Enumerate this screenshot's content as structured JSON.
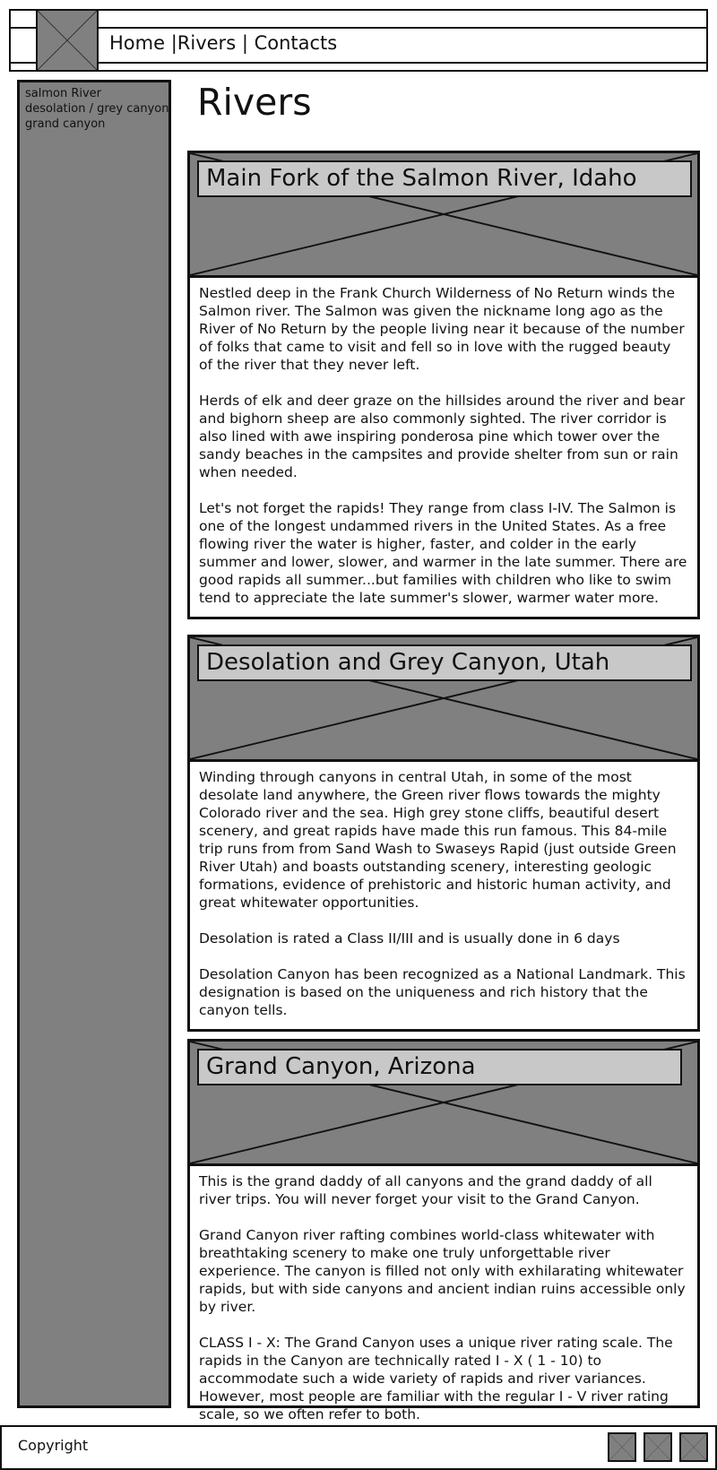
{
  "header": {
    "logo_icon": "image-placeholder-icon",
    "nav": {
      "home": "Home",
      "sep1": " |",
      "rivers": "Rivers",
      "sep2": " | ",
      "contacts": "Contacts"
    }
  },
  "sidebar": {
    "items": [
      {
        "label": "salmon River"
      },
      {
        "label": "desolation / grey canyon"
      },
      {
        "label": "grand canyon"
      }
    ]
  },
  "main": {
    "title": "Rivers",
    "rivers": [
      {
        "heading": "Main Fork of the Salmon River, Idaho",
        "paragraphs": [
          "Nestled deep in the Frank Church Wilderness of No Return winds the Salmon river. The Salmon was given the nickname long ago as the River of No Return by the people living near it because of the number of folks that came to visit and fell so in love with the rugged beauty of the river that they never left.",
          "Herds of elk and deer graze on the hillsides around the river and bear and bighorn sheep are also commonly sighted. The river corridor is also lined with awe inspiring ponderosa pine which tower over the sandy beaches in the campsites and provide shelter from sun or rain when needed.",
          "Let's not forget the rapids! They range from class I-IV. The Salmon is one of the longest undammed rivers in the United States. As a free flowing river the water is higher, faster, and colder in the early summer and lower, slower, and warmer in the late summer. There are good rapids all summer...but families with children who like to swim tend to appreciate the late summer's slower, warmer water more."
        ]
      },
      {
        "heading": "Desolation and Grey Canyon, Utah",
        "paragraphs": [
          "Winding through canyons in central Utah, in some of the most desolate land anywhere, the Green river flows towards the mighty Colorado river and the sea. High grey stone cliffs, beautiful desert scenery, and great rapids have made this run famous. This 84-mile trip runs from from Sand Wash to Swaseys Rapid (just outside Green River Utah) and boasts outstanding scenery, interesting geologic formations, evidence of prehistoric and historic human activity, and great whitewater opportunities.",
          "Desolation is rated a Class II/III and is usually done in 6 days",
          "Desolation Canyon has been recognized as a National Landmark.  This designation is based on the uniqueness and rich history that the canyon tells."
        ]
      },
      {
        "heading": "Grand Canyon, Arizona",
        "paragraphs": [
          "This is the grand daddy of all canyons and the grand daddy of all river trips. You will never forget your visit to the Grand Canyon.",
          "Grand Canyon river rafting combines world-class whitewater with breathtaking scenery to make one truly unforgettable river experience. The canyon is filled not only with exhilarating whitewater rapids, but with side canyons and ancient indian ruins accessible only by river.",
          "CLASS I - X: The Grand Canyon uses a unique river rating scale. The rapids in the Canyon are technically rated I - X ( 1 - 10) to accommodate such a wide variety of rapids and river variances. However, most people are familiar with the regular I - V river rating scale, so we often refer to both."
        ]
      }
    ]
  },
  "footer": {
    "copyright": "Copyright",
    "social_icons": [
      "image-placeholder-icon",
      "image-placeholder-icon",
      "image-placeholder-icon"
    ]
  },
  "colors": {
    "placeholder_fill": "#808080",
    "heading_fill": "#c8c8c8",
    "border": "#111111",
    "background": "#ffffff"
  }
}
